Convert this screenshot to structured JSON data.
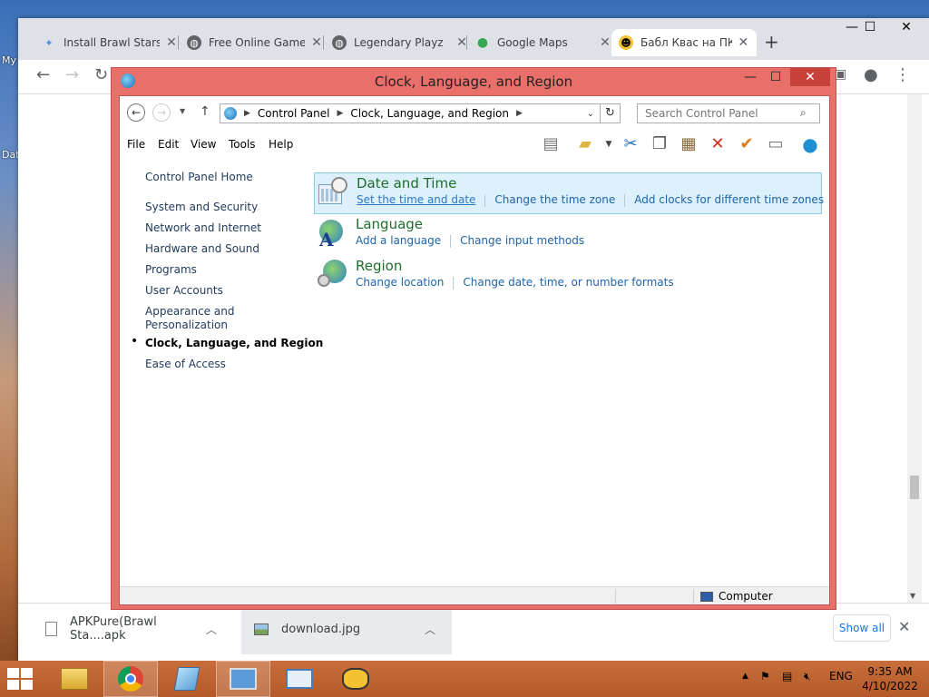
{
  "desktop": {
    "frag_my": "My",
    "frag_dat": "Dat"
  },
  "browser": {
    "tabs": [
      {
        "label": "Install Brawl Stars",
        "icon": "sparkle-icon"
      },
      {
        "label": "Free Online Games",
        "icon": "globe-icon"
      },
      {
        "label": "Legendary Playz",
        "icon": "globe-icon"
      },
      {
        "label": "Google Maps",
        "icon": "maps-pin-icon"
      },
      {
        "label": "Бабл Квас на ПК",
        "icon": "smiley-icon"
      }
    ],
    "close_glyph": "✕",
    "newtab_glyph": "+",
    "window_buttons": {
      "minimize": "—",
      "maximize": "☐",
      "close": "✕"
    }
  },
  "downloads": {
    "items": [
      {
        "label": "APKPure(Brawl Sta....apk"
      },
      {
        "label": "download.jpg"
      }
    ],
    "show_all": "Show all",
    "close_glyph": "✕"
  },
  "control_panel": {
    "title": "Clock, Language, and Region",
    "breadcrumb": [
      "Control Panel",
      "Clock, Language, and Region"
    ],
    "search_placeholder": "Search Control Panel",
    "menu": [
      "File",
      "Edit",
      "View",
      "Tools",
      "Help"
    ],
    "nav": {
      "home": "Control Panel Home",
      "items": [
        "System and Security",
        "Network and Internet",
        "Hardware and Sound",
        "Programs",
        "User Accounts",
        "Appearance and",
        "Personalization",
        "Clock, Language, and Region",
        "Ease of Access"
      ]
    },
    "categories": [
      {
        "title": "Date and Time",
        "links": [
          "Set the time and date",
          "Change the time zone",
          "Add clocks for different time zones"
        ]
      },
      {
        "title": "Language",
        "links": [
          "Add a language",
          "Change input methods"
        ]
      },
      {
        "title": "Region",
        "links": [
          "Change location",
          "Change date, time, or number formats"
        ]
      }
    ],
    "status": "Computer"
  },
  "taskbar": {
    "tray_lang": "ENG",
    "time": "9:35 AM",
    "date": "4/10/2022"
  }
}
